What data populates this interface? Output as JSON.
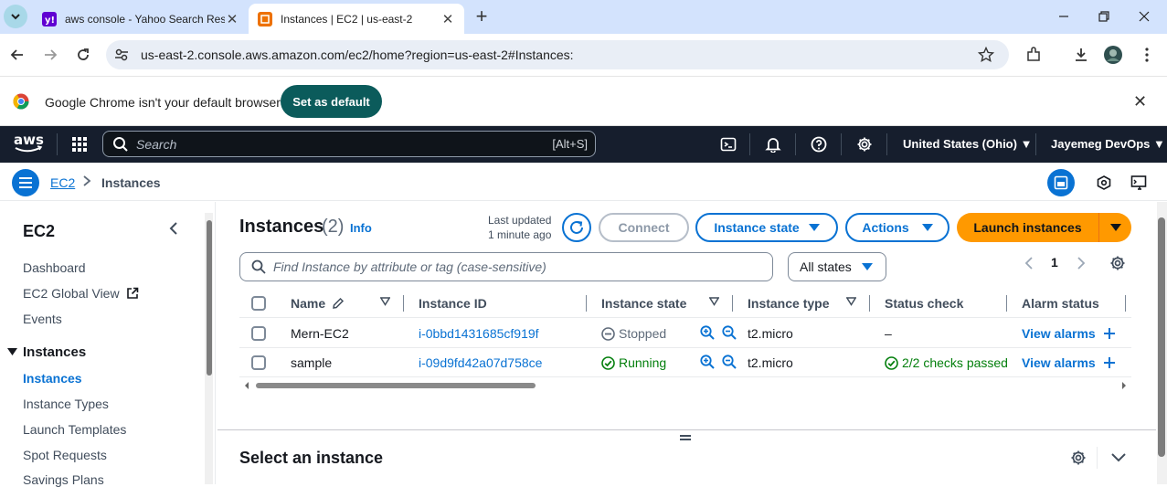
{
  "browser": {
    "tabs": [
      {
        "title": "aws console - Yahoo Search Res",
        "favicon": "yahoo-icon"
      },
      {
        "title": "Instances | EC2 | us-east-2",
        "favicon": "aws-ec2-icon",
        "active": true
      }
    ],
    "url": "us-east-2.console.aws.amazon.com/ec2/home?region=us-east-2#Instances:"
  },
  "infobar": {
    "message": "Google Chrome isn't your default browser",
    "button": "Set as default"
  },
  "aws_nav": {
    "search_placeholder": "Search",
    "search_shortcut": "[Alt+S]",
    "region": "United States (Ohio)",
    "account": "Jayemeg DevOps"
  },
  "breadcrumb": {
    "parent": "EC2",
    "current": "Instances"
  },
  "sidebar": {
    "title": "EC2",
    "top_items": [
      "Dashboard",
      "EC2 Global View",
      "Events"
    ],
    "section": "Instances",
    "section_items": [
      "Instances",
      "Instance Types",
      "Launch Templates",
      "Spot Requests",
      "Savings Plans"
    ]
  },
  "main": {
    "title": "Instances",
    "count": "(2)",
    "info": "Info",
    "last_updated_label": "Last updated",
    "last_updated_value": "1 minute ago",
    "connect": "Connect",
    "instance_state": "Instance state",
    "actions": "Actions",
    "launch": "Launch instances",
    "find_placeholder": "Find Instance by attribute or tag (case-sensitive)",
    "states_filter": "All states",
    "page": "1",
    "columns": [
      "Name",
      "Instance ID",
      "Instance state",
      "Instance type",
      "Status check",
      "Alarm status"
    ],
    "rows": [
      {
        "name": "Mern-EC2",
        "id": "i-0bbd1431685cf919f",
        "state": "Stopped",
        "type": "t2.micro",
        "status": "–",
        "alarm": "View alarms"
      },
      {
        "name": "sample",
        "id": "i-09d9fd42a07d758ce",
        "state": "Running",
        "type": "t2.micro",
        "status": "2/2 checks passed",
        "alarm": "View alarms"
      }
    ],
    "select_title": "Select an instance"
  },
  "colors": {
    "aws_nav_bg": "#161e2d",
    "primary": "#0972d3",
    "launch": "#ff9900",
    "running": "#037f0c",
    "chrome_tabbar": "#d3e3fd"
  }
}
